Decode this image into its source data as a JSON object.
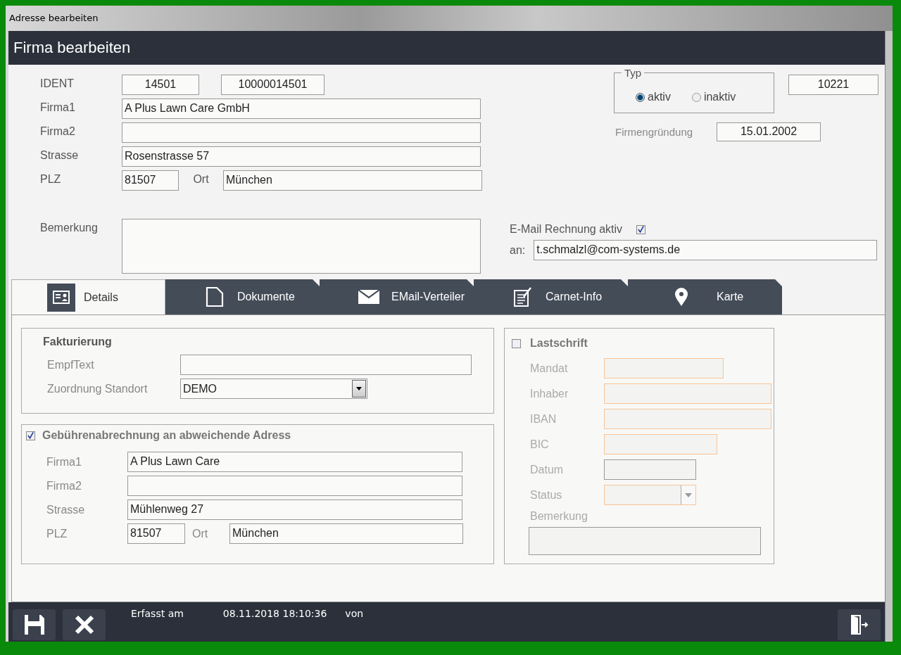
{
  "window": {
    "title": "Adresse bearbeiten"
  },
  "header": {
    "title": "Firma bearbeiten"
  },
  "address": {
    "ident_label": "IDENT",
    "ident": "14501",
    "ident_long": "10000014501",
    "fields": [
      {
        "label": "Firma1",
        "value": "A Plus Lawn Care GmbH"
      },
      {
        "label": "Firma2"
      },
      {
        "label": "Strasse",
        "value": "Rosenstrasse 57"
      }
    ],
    "plz_label": "PLZ",
    "plz": "81507",
    "ort_label": "Ort",
    "ort": "München",
    "remark_label": "Bemerkung"
  },
  "typ": {
    "legend": "Typ",
    "options": [
      {
        "label": "aktiv",
        "selected": true
      },
      {
        "label": "inaktiv",
        "selected": false
      }
    ]
  },
  "number": "10221",
  "founding": {
    "label": "Firmengründung",
    "value": "15.01.2002"
  },
  "email_invoice": {
    "label": "E-Mail Rechnung aktiv",
    "checked": true,
    "to_label": "an:",
    "address": "t.schmalzl@com-systems.de"
  },
  "tabs": [
    {
      "label": "Details",
      "selected": true
    },
    {
      "label": "Dokumente",
      "selected": false
    },
    {
      "label": "EMail-Verteiler",
      "selected": false
    },
    {
      "label": "Carnet-Info",
      "selected": false
    },
    {
      "label": "Karte",
      "selected": false
    }
  ],
  "invoicing": {
    "title": "Fakturierung",
    "text_label": "EmpfText",
    "location_label": "Zuordnung Standort",
    "location": "DEMO"
  },
  "alt_address": {
    "title": "Gebührenabrechnung an abweichende Adress",
    "checked": true,
    "fields": [
      {
        "label": "Firma1",
        "value": "A Plus Lawn Care"
      },
      {
        "label": "Firma2"
      },
      {
        "label": "Strasse",
        "value": "Mühlenweg 27"
      }
    ],
    "plz_label": "PLZ",
    "plz": "81507",
    "ort_label": "Ort",
    "ort": "München"
  },
  "direct_debit": {
    "title": "Lastschrift",
    "checked": false,
    "fields": [
      {
        "label": "Mandat",
        "kind": "text",
        "required": true
      },
      {
        "label": "Inhaber",
        "kind": "text",
        "required": true
      },
      {
        "label": "IBAN",
        "kind": "text",
        "required": true
      },
      {
        "label": "BIC",
        "kind": "text",
        "required": true
      },
      {
        "label": "Datum",
        "kind": "text",
        "required": false
      },
      {
        "label": "Status",
        "kind": "select",
        "required": true
      },
      {
        "label": "Bemerkung",
        "kind": "textarea",
        "required": false
      }
    ]
  },
  "footer": {
    "created_label": "Erfasst am",
    "created": "08.11.2018 18:10:36",
    "by_label": "von"
  }
}
